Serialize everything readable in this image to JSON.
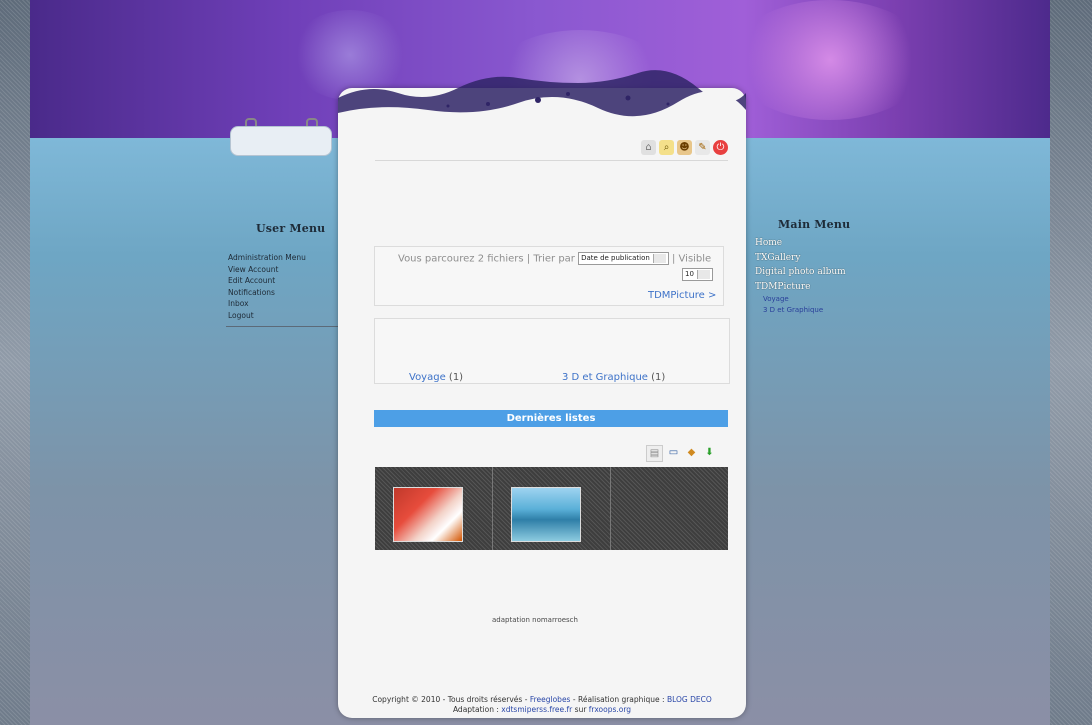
{
  "left_menu": {
    "title": "User Menu",
    "items": [
      "Administration Menu",
      "View Account",
      "Edit Account",
      "Notifications",
      "Inbox",
      "Logout"
    ]
  },
  "right_menu": {
    "title": "Main Menu",
    "items": [
      {
        "label": "Home",
        "sub": false
      },
      {
        "label": "TXGallery",
        "sub": false
      },
      {
        "label": "Digital photo album",
        "sub": false
      },
      {
        "label": "TDMPicture",
        "sub": false
      },
      {
        "label": "Voyage",
        "sub": true
      },
      {
        "label": "3 D et Graphique",
        "sub": true
      }
    ]
  },
  "toolbar_icons": [
    "home-icon",
    "search-icon",
    "users-icon",
    "tools-icon",
    "power-icon"
  ],
  "browse": {
    "text": "Vous parcourez 2 fichiers | Trier par",
    "sort_value": "Date de publication",
    "visible_label": "| Visible",
    "visible_value": "10",
    "module_link": "TDMPicture >"
  },
  "categories": [
    {
      "name": "Voyage",
      "count": "(1)"
    },
    {
      "name": "3 D et Graphique",
      "count": "(1)"
    }
  ],
  "latest_title": "Dernières listes",
  "view_icons": [
    "list-view-icon",
    "monitor-icon",
    "slideshow-icon",
    "download-icon"
  ],
  "footer": {
    "adaptation": "adaptation nomarroesch",
    "copyright": "Copyright © 2010 - Tous droits réservés -",
    "host": "Freeglobes",
    "sep": "- Réalisation graphique :",
    "designer": "BLOG DECO",
    "adaptation_prefix": "Adaptation :",
    "adapt_link1": "xdtsmiperss.free.fr",
    "adapt_sep": "sur",
    "adapt_link2": "frxoops.org"
  },
  "colors": {
    "accent_bar": "#4d9fe6",
    "link": "#3d72c8",
    "banner": "#6f3fb8"
  }
}
